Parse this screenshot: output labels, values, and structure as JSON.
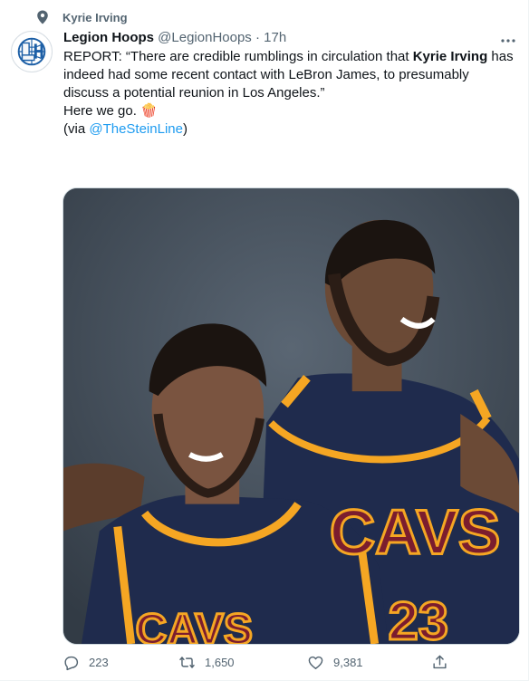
{
  "topic": {
    "icon": "location-pin-icon",
    "label": "Kyrie Irving"
  },
  "tweet": {
    "author": {
      "name": "Legion Hoops",
      "handle": "@LegionHoops",
      "separator": "·",
      "time": "17h",
      "avatar_icon": "legion-hoops-logo"
    },
    "text": {
      "p1_before": "REPORT: “There are credible rumblings in circulation that ",
      "p1_bold": "Kyrie Irving",
      "p1_after": " has indeed had some recent contact with LeBron James, to presumably discuss a potential reunion in Los Angeles.”",
      "p2": "Here we go. 🍿",
      "p3_prefix": "(via ",
      "p3_mention": "@TheSteinLine",
      "p3_suffix": ")"
    },
    "media": {
      "description_icon": "photo-kyrie-lebron-cavs"
    },
    "actions": {
      "replies": "223",
      "retweets": "1,650",
      "likes": "9,381"
    }
  },
  "colors": {
    "text": "#0f1419",
    "secondary": "#536471",
    "link": "#1d9bf0",
    "jersey_navy": "#1f2b4d",
    "jersey_trim": "#f5a623",
    "jersey_wine": "#7b1d2e"
  }
}
